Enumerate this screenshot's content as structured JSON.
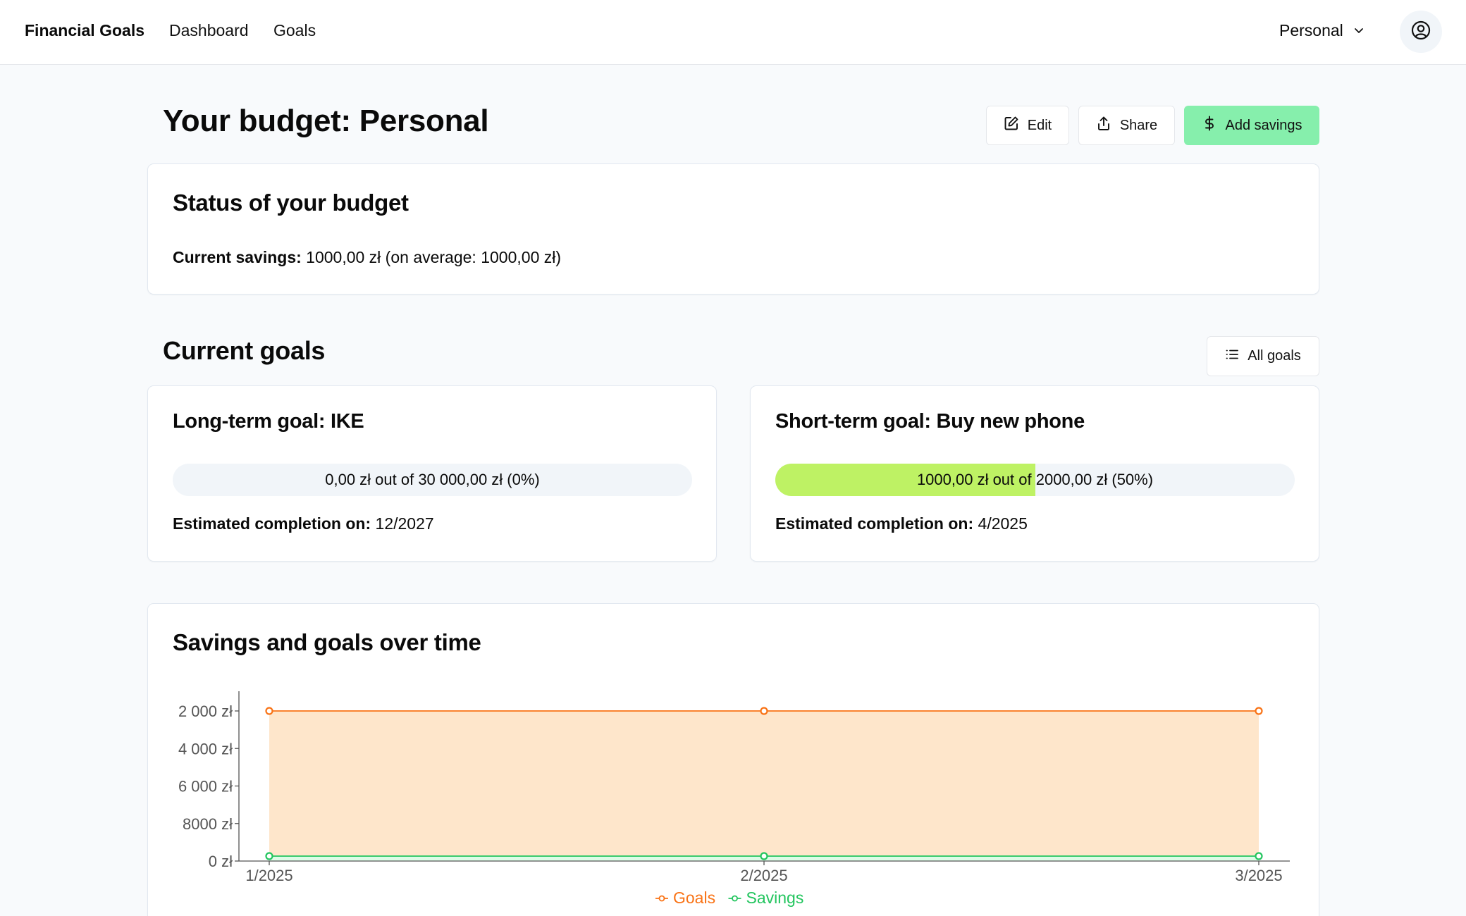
{
  "nav": {
    "brand": "Financial Goals",
    "links": [
      "Dashboard",
      "Goals"
    ],
    "budget_selector": "Personal"
  },
  "header": {
    "title": "Your budget: Personal",
    "buttons": {
      "edit": "Edit",
      "share": "Share",
      "add_savings": "Add savings"
    }
  },
  "status": {
    "title": "Status of your budget",
    "savings_label": "Current savings:",
    "savings_value": "1000,00 zł (on average: 1000,00 zł)"
  },
  "goals": {
    "title": "Current goals",
    "all_goals_button": "All goals",
    "items": [
      {
        "title": "Long-term goal: IKE",
        "progress_text": "0,00 zł out of 30 000,00 zł (0%)",
        "progress_fraction": 0,
        "est_label": "Estimated completion on:",
        "est_value": "12/2027"
      },
      {
        "title": "Short-term goal: Buy new phone",
        "progress_text": "1000,00 zł out of 2000,00 zł (50%)",
        "progress_fraction": 0.5,
        "est_label": "Estimated completion on:",
        "est_value": "4/2025"
      }
    ]
  },
  "chart_section": {
    "title": "Savings and goals over time"
  },
  "chart_data": {
    "type": "area",
    "categories": [
      "1/2025",
      "2/2025",
      "3/2025"
    ],
    "y_tick_labels": [
      "2 000 zł",
      "4 000 zł",
      "6 000 zł",
      "8000 zł",
      "0 zł"
    ],
    "series": [
      {
        "name": "Goals",
        "values": [
          2000,
          2000,
          2000
        ],
        "color": "#f97316",
        "fill": "#fee6cb"
      },
      {
        "name": "Savings",
        "values": [
          0,
          0,
          0
        ],
        "color": "#22c55e",
        "fill": "#dcfce7"
      }
    ],
    "ylim": [
      0,
      2000
    ],
    "legend": "bottom-center",
    "grid": false
  },
  "colors": {
    "accent_green": "#86efac",
    "progress_fill": "#bef264",
    "goals_line": "#f97316",
    "savings_line": "#22c55e"
  },
  "icons": {
    "edit": "pencil-square-icon",
    "share": "upload-share-icon",
    "add": "dollar-icon",
    "list": "list-icon",
    "user": "user-circle-icon",
    "chevron": "chevron-down-icon"
  }
}
